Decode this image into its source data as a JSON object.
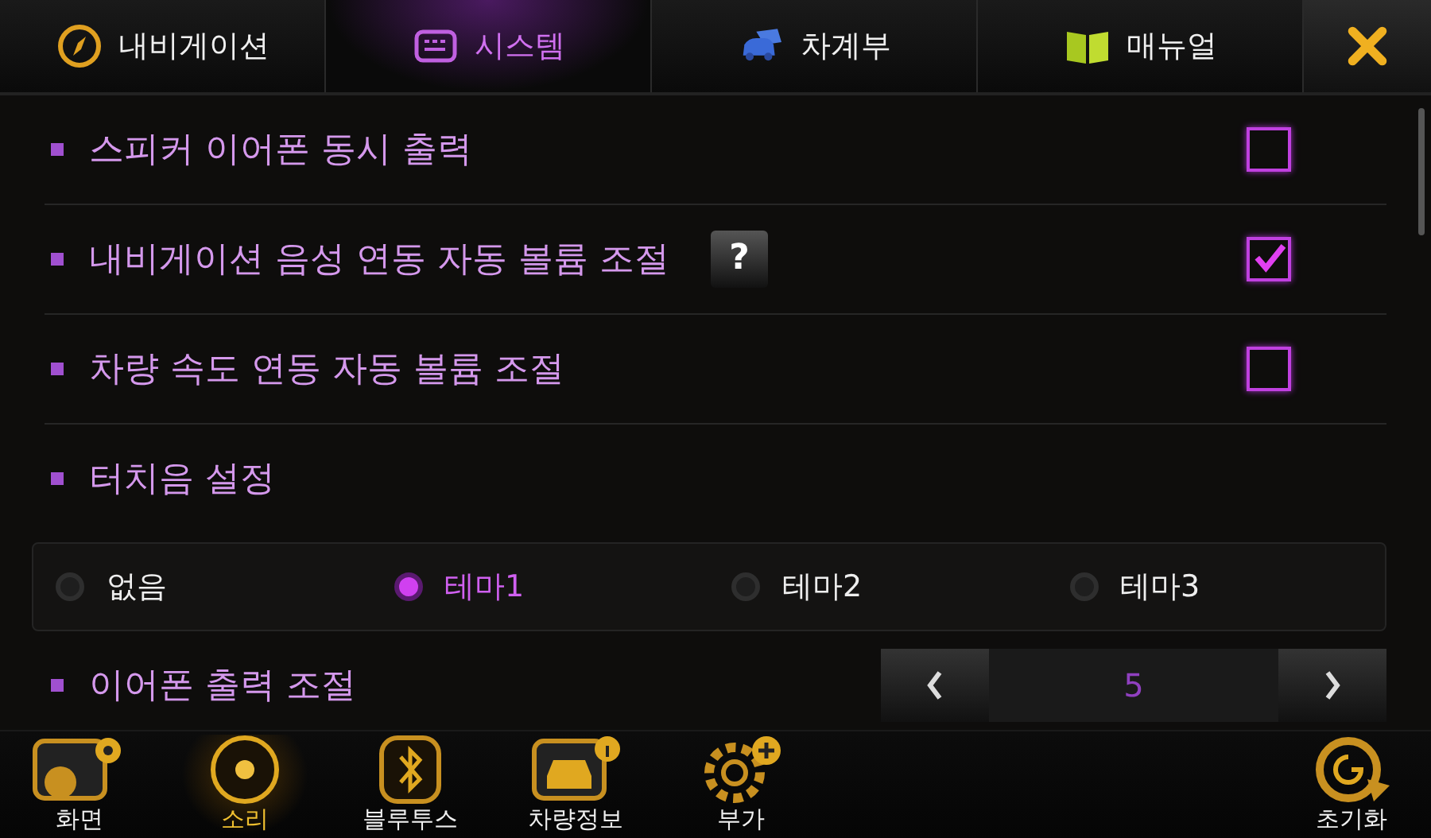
{
  "tabs": [
    {
      "label": "내비게이션",
      "selected": false
    },
    {
      "label": "시스템",
      "selected": true
    },
    {
      "label": "차계부",
      "selected": false
    },
    {
      "label": "매뉴얼",
      "selected": false
    }
  ],
  "settings": [
    {
      "kind": "checkbox",
      "label": "스피커 이어폰 동시 출력",
      "checked": false
    },
    {
      "kind": "checkbox",
      "label": "내비게이션 음성 연동 자동 볼륨 조절",
      "checked": true,
      "help": "?"
    },
    {
      "kind": "checkbox",
      "label": "차량 속도 연동 자동 볼륨 조절",
      "checked": false
    },
    {
      "kind": "header",
      "label": "터치음 설정"
    },
    {
      "kind": "radio",
      "options": [
        {
          "label": "없음",
          "selected": false
        },
        {
          "label": "테마1",
          "selected": true
        },
        {
          "label": "테마2",
          "selected": false
        },
        {
          "label": "테마3",
          "selected": false
        }
      ]
    },
    {
      "kind": "stepper",
      "label": "이어폰 출력 조절",
      "value": "5"
    }
  ],
  "dock": [
    {
      "label": "화면",
      "selected": false
    },
    {
      "label": "소리",
      "selected": true
    },
    {
      "label": "블루투스",
      "selected": false
    },
    {
      "label": "차량정보",
      "selected": false
    },
    {
      "label": "부가",
      "selected": false
    }
  ],
  "reset": {
    "label": "초기화"
  }
}
